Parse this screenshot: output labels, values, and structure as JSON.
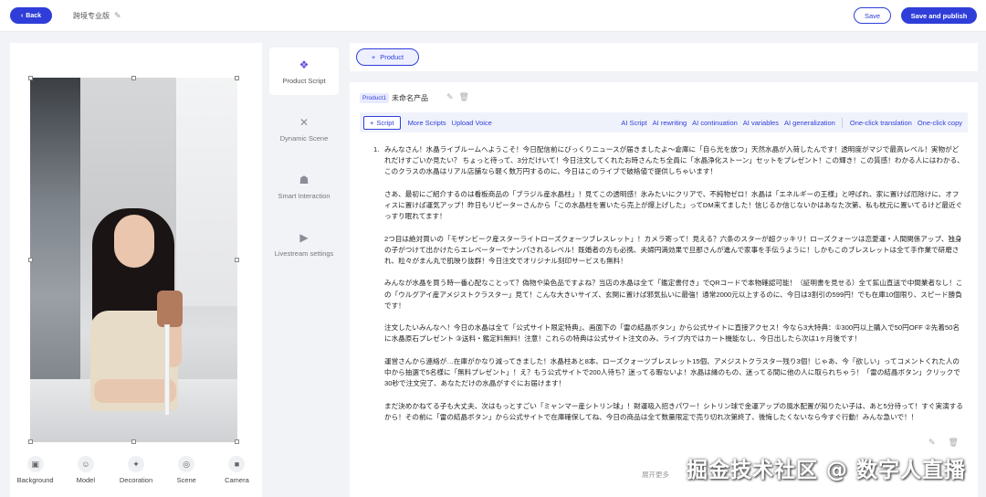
{
  "header": {
    "back_label": "Back",
    "project_title": "跨境专业版",
    "save_label": "Save",
    "publish_label": "Save and publish"
  },
  "preview": {
    "tools": [
      {
        "label": "Background",
        "icon": "image-icon"
      },
      {
        "label": "Model",
        "icon": "person-icon"
      },
      {
        "label": "Decoration",
        "icon": "sparkle-icon"
      },
      {
        "label": "Scene",
        "icon": "location-icon"
      },
      {
        "label": "Camera",
        "icon": "camera-icon"
      }
    ]
  },
  "nav": {
    "items": [
      {
        "label": "Product Script",
        "icon": "product-script-icon",
        "active": true
      },
      {
        "label": "Dynamic Scene",
        "icon": "dynamic-scene-icon",
        "active": false
      },
      {
        "label": "Smart Interaction",
        "icon": "robot-icon",
        "active": false
      },
      {
        "label": "Livestream settings",
        "icon": "video-icon",
        "active": false
      }
    ]
  },
  "editor": {
    "add_product_label": "Product",
    "product_tag": "Product1",
    "product_name": "未命名产品",
    "toolbar": {
      "script": "Script",
      "more_scripts": "More Scripts",
      "upload_voice": "Upload Voice",
      "ai_script": "AI Script",
      "ai_rewriting": "AI rewriting",
      "ai_continuation": "AI continuation",
      "ai_variables": "AI variables",
      "ai_generalization": "AI generalization",
      "one_click_translation": "One-click translation",
      "one_click_copy": "One-click copy"
    },
    "item_number": "1.",
    "paragraphs": [
      "みんなさん！水晶ライブルームへようこそ！今日配信前にびっくりニュースが届きましたよ～倉庫に「自ら光を放つ」天然水晶が入荷したんです！透明度がマジで最高レベル！実物がどれだけすごいか見たい？ ちょっと待って、3分だけいて！今日注文してくれたお時さんたち全員に「水晶浄化ストーン」セットをプレゼント！この輝き！この質感！わかる人にはわかる、このクラスの水晶はリアル店舗なら軽く数万円するのに、今日はこのライブで破格値で提供しちゃいます！",
      "さあ、最初にご紹介するのは看板商品の「ブラジル産水晶柱」！見てこの透明感！氷みたいにクリアで、不純物ゼロ！水晶は「エネルギーの王様」と呼ばれ、家に置けば厄除けに、オフィスに置けば運気アップ！昨日もリピーターさんから「この水晶柱を置いたら売上が爆上げした」ってDM来てました！信じるか信じないかはあなた次第、私も枕元に置いてるけど最近ぐっすり眠れてます！",
      "2つ目は絶対買いの「モザンビーク産スターライトローズクォーツブレスレット」！カメラ寄って！見える？六条のスターが超クッキリ！ローズクォーツは恋愛運・人間関係アップ、独身の子がつけて出かけたらエレベーターでナンパされるレベル！既婚者の方も必携、夫婦円満効果で旦那さんが進んで家事を手伝うように！しかもこのブレスレットは全て手作業で研磨され、粒々がまん丸で肌映り抜群！今日注文でオリジナル刻印サービスも無料！",
      "みんなが水晶を買う時一番心配なことって？偽物や染色品ですよね？当店の水晶は全て「鑑定書付き」でQRコードで本物確認可能！（証明書を見せる）全て鉱山直送で中間業者なし！この「ウルグアイ産アメジストクラスター」見て！こんな大きいサイズ、玄関に置けば邪気払いに最強！通常2000元以上するのに、今日は3割引の599円！でも在庫10個限り、スピード勝負です！",
      "注文したいみんなへ！今日の水晶は全て「公式サイト限定特典」、画面下の「雷の結晶ボタン」から公式サイトに直接アクセス！今なら3大特典：①300円以上購入で50円OFF ②先着50名に水晶原石プレゼント ③送料・鑑定料無料！注意！これらの特典は公式サイト注文のみ、ライブ内ではカート機能なし、今日出したら次は1ヶ月後です！",
      "運営さんから連絡が…在庫がかなり減ってきました！水晶柱あと8本、ローズクォーツブレスレット15個、アメジストクラスター残り3個！じゃあ、今「欲しい」ってコメントくれた人の中から抽選で5名様に「無料プレゼント」！え？もう公式サイトで200人待ち？迷ってる暇ないよ！水晶は縁のもの、迷ってる間に他の人に取られちゃう！「雷の結晶ボタン」クリックで30秒で注文完了、あなただけの水晶がすぐにお届けます！",
      "まだ決めかねてる子も大丈夫、次はもっとすごい「ミャンマー産シトリン球」！財運吸入招きパワー！シトリン球で金運アップの風水配置が知りたい子は、あと5分待って！すぐ実演するから！その前に「雷の結晶ボタン」から公式サイトで在庫確保してね、今日の商品は全て数量限定で売り切れ次第終了、後悔したくないなら今すぐ行動！みんな急いで！！"
    ],
    "expand_label": "展开更多"
  },
  "watermark": "掘金技术社区 @ 数字人直播",
  "colors": {
    "accent": "#2f3ed9",
    "accent_light": "#e8ebff",
    "nav_active_icon": "#6d4ce0"
  }
}
